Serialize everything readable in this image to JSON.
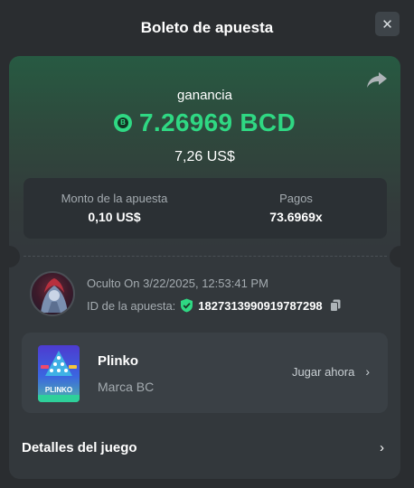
{
  "header": {
    "title": "Boleto de apuesta",
    "close_icon": "close-icon",
    "close_glyph": "✕"
  },
  "win": {
    "label": "ganancia",
    "amount": "7.26969 BCD",
    "coin_icon": "bcd-coin-icon",
    "coin_glyph": "B",
    "usd": "7,26 US$",
    "accent_color": "#2fd883"
  },
  "stats": {
    "bet_label": "Monto de la apuesta",
    "bet_value": "0,10 US$",
    "payout_label": "Pagos",
    "payout_value": "73.6969x"
  },
  "user": {
    "line": "Oculto On 3/22/2025, 12:53:41 PM",
    "bet_id_label": "ID de la apuesta:",
    "bet_id": "182731399091978729​8"
  },
  "game": {
    "name": "Plinko",
    "brand": "Marca BC",
    "thumb_text": "PLINKO",
    "play_label": "Jugar ahora",
    "chevron": "›"
  },
  "details": {
    "label": "Detalles del juego",
    "chevron": "›"
  }
}
